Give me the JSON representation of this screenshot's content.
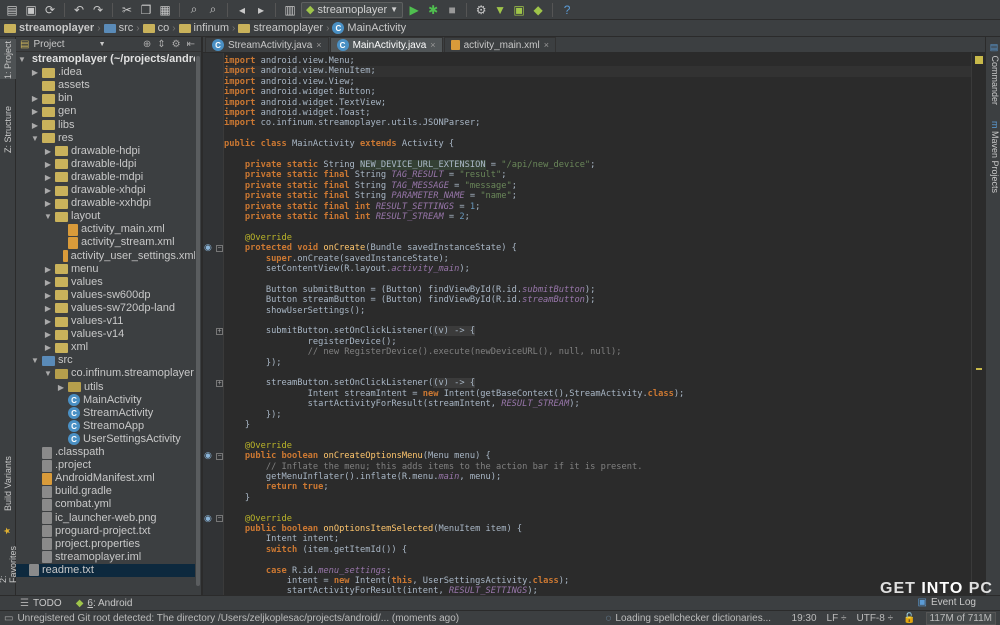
{
  "colors": {
    "keyword": "#cc7832",
    "string": "#6a8759",
    "number": "#6897bb",
    "annotation": "#bbb529",
    "method": "#ffc66d",
    "field": "#9876aa",
    "comment": "#808080",
    "background": "#2b2b2b",
    "panel": "#3c3f41"
  },
  "toolbar": {
    "icons": [
      "open-folder-icon",
      "save-icon",
      "sync-icon",
      "undo-icon",
      "redo-icon",
      "cut-icon",
      "copy-icon",
      "paste-icon",
      "find-icon",
      "replace-icon",
      "back-icon",
      "forward-icon",
      "make-icon",
      "run-config-icon"
    ],
    "run_config_label": "streamoplayer",
    "trailing_icons": [
      "run-icon",
      "debug-icon",
      "stop-icon",
      "sdk-manager-icon",
      "avd-manager-icon",
      "android-icon",
      "help-icon"
    ]
  },
  "breadcrumb": [
    "streamoplayer",
    "src",
    "co",
    "infinum",
    "streamoplayer",
    "MainActivity"
  ],
  "left_strip": {
    "project_tab": "1: Project",
    "structure_tab": "Z: Structure",
    "build_variants_tab": "Build Variants",
    "favorites_tab": "2: Favorites"
  },
  "project_panel": {
    "view_label": "Project",
    "tree": [
      {
        "label": "streamoplayer (~/projects/android/",
        "depth": 0,
        "kind": "root",
        "arrow": "▼"
      },
      {
        "label": ".idea",
        "depth": 1,
        "kind": "folder",
        "arrow": "▶"
      },
      {
        "label": "assets",
        "depth": 1,
        "kind": "folder",
        "arrow": ""
      },
      {
        "label": "bin",
        "depth": 1,
        "kind": "folder",
        "arrow": "▶"
      },
      {
        "label": "gen",
        "depth": 1,
        "kind": "folder",
        "arrow": "▶"
      },
      {
        "label": "libs",
        "depth": 1,
        "kind": "folder",
        "arrow": "▶"
      },
      {
        "label": "res",
        "depth": 1,
        "kind": "folder",
        "arrow": "▼"
      },
      {
        "label": "drawable-hdpi",
        "depth": 2,
        "kind": "folder",
        "arrow": "▶"
      },
      {
        "label": "drawable-ldpi",
        "depth": 2,
        "kind": "folder",
        "arrow": "▶"
      },
      {
        "label": "drawable-mdpi",
        "depth": 2,
        "kind": "folder",
        "arrow": "▶"
      },
      {
        "label": "drawable-xhdpi",
        "depth": 2,
        "kind": "folder",
        "arrow": "▶"
      },
      {
        "label": "drawable-xxhdpi",
        "depth": 2,
        "kind": "folder",
        "arrow": "▶"
      },
      {
        "label": "layout",
        "depth": 2,
        "kind": "folder",
        "arrow": "▼"
      },
      {
        "label": "activity_main.xml",
        "depth": 3,
        "kind": "xml",
        "arrow": ""
      },
      {
        "label": "activity_stream.xml",
        "depth": 3,
        "kind": "xml",
        "arrow": ""
      },
      {
        "label": "activity_user_settings.xml",
        "depth": 3,
        "kind": "xml",
        "arrow": ""
      },
      {
        "label": "menu",
        "depth": 2,
        "kind": "folder",
        "arrow": "▶"
      },
      {
        "label": "values",
        "depth": 2,
        "kind": "folder",
        "arrow": "▶"
      },
      {
        "label": "values-sw600dp",
        "depth": 2,
        "kind": "folder",
        "arrow": "▶"
      },
      {
        "label": "values-sw720dp-land",
        "depth": 2,
        "kind": "folder",
        "arrow": "▶"
      },
      {
        "label": "values-v11",
        "depth": 2,
        "kind": "folder",
        "arrow": "▶"
      },
      {
        "label": "values-v14",
        "depth": 2,
        "kind": "folder",
        "arrow": "▶"
      },
      {
        "label": "xml",
        "depth": 2,
        "kind": "folder",
        "arrow": "▶"
      },
      {
        "label": "src",
        "depth": 1,
        "kind": "src",
        "arrow": "▼"
      },
      {
        "label": "co.infinum.streamoplayer",
        "depth": 2,
        "kind": "pkg",
        "arrow": "▼"
      },
      {
        "label": "utils",
        "depth": 3,
        "kind": "pkg",
        "arrow": "▶"
      },
      {
        "label": "MainActivity",
        "depth": 3,
        "kind": "class",
        "arrow": ""
      },
      {
        "label": "StreamActivity",
        "depth": 3,
        "kind": "class",
        "arrow": ""
      },
      {
        "label": "StreamoApp",
        "depth": 3,
        "kind": "class",
        "arrow": ""
      },
      {
        "label": "UserSettingsActivity",
        "depth": 3,
        "kind": "class",
        "arrow": ""
      },
      {
        "label": ".classpath",
        "depth": 1,
        "kind": "file",
        "arrow": ""
      },
      {
        "label": ".project",
        "depth": 1,
        "kind": "file",
        "arrow": ""
      },
      {
        "label": "AndroidManifest.xml",
        "depth": 1,
        "kind": "xml",
        "arrow": ""
      },
      {
        "label": "build.gradle",
        "depth": 1,
        "kind": "file",
        "arrow": ""
      },
      {
        "label": "combat.yml",
        "depth": 1,
        "kind": "file",
        "arrow": ""
      },
      {
        "label": "ic_launcher-web.png",
        "depth": 1,
        "kind": "file",
        "arrow": ""
      },
      {
        "label": "proguard-project.txt",
        "depth": 1,
        "kind": "file",
        "arrow": ""
      },
      {
        "label": "project.properties",
        "depth": 1,
        "kind": "file",
        "arrow": ""
      },
      {
        "label": "streamoplayer.iml",
        "depth": 1,
        "kind": "file",
        "arrow": ""
      },
      {
        "label": "readme.txt",
        "depth": 0,
        "kind": "file",
        "arrow": "",
        "selected": true
      }
    ]
  },
  "tabs": [
    {
      "label": "StreamActivity.java",
      "active": false,
      "icon": "class-icon"
    },
    {
      "label": "MainActivity.java",
      "active": true,
      "icon": "class-icon"
    },
    {
      "label": "activity_main.xml",
      "active": false,
      "icon": "xml-file-icon"
    }
  ],
  "editor": {
    "caret_line": 1,
    "gutter_markers": [
      18,
      38,
      44
    ],
    "fold_markers": [
      18,
      26,
      31,
      38,
      44
    ],
    "lines": [
      [
        [
          "k",
          "import "
        ],
        [
          "t",
          "android.view.Menu;"
        ]
      ],
      [
        [
          "k",
          "import "
        ],
        [
          "t",
          "android.view.MenuItem;"
        ]
      ],
      [
        [
          "k",
          "import "
        ],
        [
          "t",
          "android.view.View;"
        ]
      ],
      [
        [
          "k",
          "import "
        ],
        [
          "t",
          "android.widget.Button;"
        ]
      ],
      [
        [
          "k",
          "import "
        ],
        [
          "t",
          "android.widget.TextView;"
        ]
      ],
      [
        [
          "k",
          "import "
        ],
        [
          "t",
          "android.widget.Toast;"
        ]
      ],
      [
        [
          "k",
          "import "
        ],
        [
          "t",
          "co.infinum.streamoplayer.utils.JSONParser;"
        ]
      ],
      [],
      [
        [
          "k",
          "public class "
        ],
        [
          "t",
          "MainActivity "
        ],
        [
          "k",
          "extends "
        ],
        [
          "t",
          "Activity {"
        ]
      ],
      [],
      [
        [
          "t",
          "    "
        ],
        [
          "k",
          "private static "
        ],
        [
          "t",
          "String "
        ],
        [
          "hl",
          "NEW_DEVICE_URL_EXTENSION"
        ],
        [
          "t",
          " = "
        ],
        [
          "s",
          "\"/api/new_device\""
        ],
        [
          "t",
          ";"
        ]
      ],
      [
        [
          "t",
          "    "
        ],
        [
          "k",
          "private static final "
        ],
        [
          "t",
          "String "
        ],
        [
          "st",
          "TAG_RESULT"
        ],
        [
          "t",
          " = "
        ],
        [
          "s",
          "\"result\""
        ],
        [
          "t",
          ";"
        ]
      ],
      [
        [
          "t",
          "    "
        ],
        [
          "k",
          "private static final "
        ],
        [
          "t",
          "String "
        ],
        [
          "st",
          "TAG_MESSAGE"
        ],
        [
          "t",
          " = "
        ],
        [
          "s",
          "\"message\""
        ],
        [
          "t",
          ";"
        ]
      ],
      [
        [
          "t",
          "    "
        ],
        [
          "k",
          "private static final "
        ],
        [
          "t",
          "String "
        ],
        [
          "st",
          "PARAMETER_NAME"
        ],
        [
          "t",
          " = "
        ],
        [
          "s",
          "\"name\""
        ],
        [
          "t",
          ";"
        ]
      ],
      [
        [
          "t",
          "    "
        ],
        [
          "k",
          "private static final int "
        ],
        [
          "st",
          "RESULT_SETTINGS"
        ],
        [
          "t",
          " = "
        ],
        [
          "n",
          "1"
        ],
        [
          "t",
          ";"
        ]
      ],
      [
        [
          "t",
          "    "
        ],
        [
          "k",
          "private static final int "
        ],
        [
          "st",
          "RESULT_STREAM"
        ],
        [
          "t",
          " = "
        ],
        [
          "n",
          "2"
        ],
        [
          "t",
          ";"
        ]
      ],
      [],
      [
        [
          "t",
          "    "
        ],
        [
          "a",
          "@Override"
        ]
      ],
      [
        [
          "t",
          "    "
        ],
        [
          "k",
          "protected void "
        ],
        [
          "m",
          "onCreate"
        ],
        [
          "t",
          "(Bundle savedInstanceState) {"
        ]
      ],
      [
        [
          "t",
          "        "
        ],
        [
          "k",
          "super"
        ],
        [
          "t",
          ".onCreate(savedInstanceState);"
        ]
      ],
      [
        [
          "t",
          "        setContentView(R.layout."
        ],
        [
          "st",
          "activity_main"
        ],
        [
          "t",
          ");"
        ]
      ],
      [],
      [
        [
          "t",
          "        Button submitButton = (Button) findViewById(R.id."
        ],
        [
          "st",
          "submitButton"
        ],
        [
          "t",
          ");"
        ]
      ],
      [
        [
          "t",
          "        Button streamButton = (Button) findViewById(R.id."
        ],
        [
          "st",
          "streamButton"
        ],
        [
          "t",
          ");"
        ]
      ],
      [
        [
          "t",
          "        showUserSettings();"
        ]
      ],
      [],
      [
        [
          "t",
          "        submitButton.setOnClickListener("
        ],
        [
          "lam",
          "(v) -> {"
        ]
      ],
      [
        [
          "t",
          "                registerDevice();"
        ]
      ],
      [
        [
          "t",
          "                "
        ],
        [
          "c",
          "// new RegisterDevice().execute(newDeviceURL(), null, null);"
        ]
      ],
      [
        [
          "t",
          "        });"
        ]
      ],
      [],
      [
        [
          "t",
          "        streamButton.setOnClickListener("
        ],
        [
          "lam",
          "(v) -> {"
        ]
      ],
      [
        [
          "t",
          "                Intent streamIntent = "
        ],
        [
          "k",
          "new "
        ],
        [
          "t",
          "Intent(getBaseContext(),StreamActivity."
        ],
        [
          "k",
          "class"
        ],
        [
          "t",
          ");"
        ]
      ],
      [
        [
          "t",
          "                startActivityForResult(streamIntent, "
        ],
        [
          "st",
          "RESULT_STREAM"
        ],
        [
          "t",
          ");"
        ]
      ],
      [
        [
          "t",
          "        });"
        ]
      ],
      [
        [
          "t",
          "    }"
        ]
      ],
      [],
      [
        [
          "t",
          "    "
        ],
        [
          "a",
          "@Override"
        ]
      ],
      [
        [
          "t",
          "    "
        ],
        [
          "k",
          "public boolean "
        ],
        [
          "m",
          "onCreateOptionsMenu"
        ],
        [
          "t",
          "(Menu menu) {"
        ]
      ],
      [
        [
          "t",
          "        "
        ],
        [
          "c",
          "// Inflate the menu; this adds items to the action bar if it is present."
        ]
      ],
      [
        [
          "t",
          "        getMenuInflater().inflate(R.menu."
        ],
        [
          "st",
          "main"
        ],
        [
          "t",
          ", menu);"
        ]
      ],
      [
        [
          "t",
          "        "
        ],
        [
          "k",
          "return true"
        ],
        [
          "t",
          ";"
        ]
      ],
      [
        [
          "t",
          "    }"
        ]
      ],
      [],
      [
        [
          "t",
          "    "
        ],
        [
          "a",
          "@Override"
        ]
      ],
      [
        [
          "t",
          "    "
        ],
        [
          "k",
          "public boolean "
        ],
        [
          "m",
          "onOptionsItemSelected"
        ],
        [
          "t",
          "(MenuItem item) {"
        ]
      ],
      [
        [
          "t",
          "        Intent intent;"
        ]
      ],
      [
        [
          "t",
          "        "
        ],
        [
          "k",
          "switch "
        ],
        [
          "t",
          "(item.getItemId()) {"
        ]
      ],
      [],
      [
        [
          "t",
          "        "
        ],
        [
          "k",
          "case "
        ],
        [
          "t",
          "R.id."
        ],
        [
          "st",
          "menu_settings"
        ],
        [
          "t",
          ":"
        ]
      ],
      [
        [
          "t",
          "            intent = "
        ],
        [
          "k",
          "new "
        ],
        [
          "t",
          "Intent("
        ],
        [
          "k",
          "this"
        ],
        [
          "t",
          ", UserSettingsActivity."
        ],
        [
          "k",
          "class"
        ],
        [
          "t",
          ");"
        ]
      ],
      [
        [
          "t",
          "            startActivityForResult(intent, "
        ],
        [
          "st",
          "RESULT_SETTINGS"
        ],
        [
          "t",
          ");"
        ]
      ]
    ]
  },
  "right_strip": {
    "commander_tab": "Commander",
    "maven_tab": "Maven Projects"
  },
  "bottom_tools": {
    "todo_label": "TODO",
    "android_num": "6",
    "android_label": ": Android",
    "event_log_label": "Event Log"
  },
  "status": {
    "message": "Unregistered Git root detected: The directory /Users/zeljkoplesac/projects/android/... (moments ago)",
    "spellcheck": "Loading spellchecker dictionaries...",
    "position": "19:30",
    "line_sep": "LF ÷",
    "encoding": "UTF-8 ÷",
    "memory": "117M of 711M"
  },
  "watermark": {
    "part1": "GET ",
    "part2": "INTO",
    "part3": " PC"
  }
}
